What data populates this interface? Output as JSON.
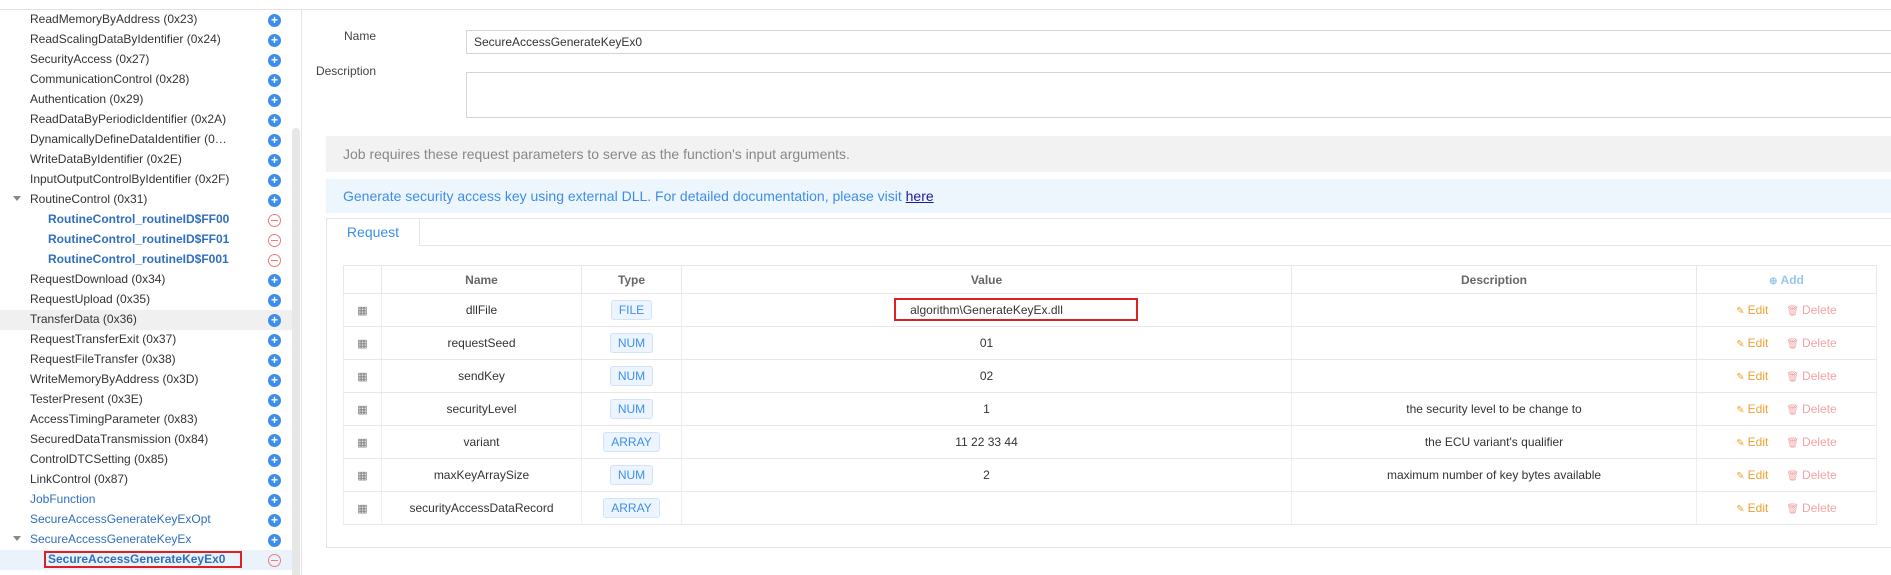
{
  "sidebar": {
    "items": [
      {
        "label": "ReadMemoryByAddress (0x23)",
        "style": "normal",
        "indent": 1,
        "action": "add"
      },
      {
        "label": "ReadScalingDataByIdentifier (0x24)",
        "style": "normal",
        "indent": 1,
        "action": "add"
      },
      {
        "label": "SecurityAccess (0x27)",
        "style": "normal",
        "indent": 1,
        "action": "add"
      },
      {
        "label": "CommunicationControl (0x28)",
        "style": "normal",
        "indent": 1,
        "action": "add"
      },
      {
        "label": "Authentication (0x29)",
        "style": "normal",
        "indent": 1,
        "action": "add"
      },
      {
        "label": "ReadDataByPeriodicIdentifier (0x2A)",
        "style": "normal",
        "indent": 1,
        "action": "add"
      },
      {
        "label": "DynamicallyDefineDataIdentifier (0…",
        "style": "normal",
        "indent": 1,
        "action": "add"
      },
      {
        "label": "WriteDataByIdentifier (0x2E)",
        "style": "normal",
        "indent": 1,
        "action": "add"
      },
      {
        "label": "InputOutputControlByIdentifier (0x2F)",
        "style": "normal",
        "indent": 1,
        "action": "add"
      },
      {
        "label": "RoutineControl (0x31)",
        "style": "normal",
        "indent": 1,
        "action": "add",
        "expanded": true
      },
      {
        "label": "RoutineControl_routineID$FF00",
        "style": "bold",
        "indent": 2,
        "action": "remove"
      },
      {
        "label": "RoutineControl_routineID$FF01",
        "style": "bold",
        "indent": 2,
        "action": "remove"
      },
      {
        "label": "RoutineControl_routineID$F001",
        "style": "bold",
        "indent": 2,
        "action": "remove"
      },
      {
        "label": "RequestDownload (0x34)",
        "style": "normal",
        "indent": 1,
        "action": "add"
      },
      {
        "label": "RequestUpload (0x35)",
        "style": "normal",
        "indent": 1,
        "action": "add"
      },
      {
        "label": "TransferData (0x36)",
        "style": "normal",
        "indent": 1,
        "action": "add",
        "highlight": true
      },
      {
        "label": "RequestTransferExit (0x37)",
        "style": "normal",
        "indent": 1,
        "action": "add"
      },
      {
        "label": "RequestFileTransfer (0x38)",
        "style": "normal",
        "indent": 1,
        "action": "add"
      },
      {
        "label": "WriteMemoryByAddress (0x3D)",
        "style": "normal",
        "indent": 1,
        "action": "add"
      },
      {
        "label": "TesterPresent (0x3E)",
        "style": "normal",
        "indent": 1,
        "action": "add"
      },
      {
        "label": "AccessTimingParameter (0x83)",
        "style": "normal",
        "indent": 1,
        "action": "add"
      },
      {
        "label": "SecuredDataTransmission (0x84)",
        "style": "normal",
        "indent": 1,
        "action": "add"
      },
      {
        "label": "ControlDTCSetting (0x85)",
        "style": "normal",
        "indent": 1,
        "action": "add"
      },
      {
        "label": "LinkControl (0x87)",
        "style": "normal",
        "indent": 1,
        "action": "add"
      },
      {
        "label": "JobFunction",
        "style": "blue",
        "indent": 1,
        "action": "add"
      },
      {
        "label": "SecureAccessGenerateKeyExOpt",
        "style": "blue",
        "indent": 1,
        "action": "add"
      },
      {
        "label": "SecureAccessGenerateKeyEx",
        "style": "blue",
        "indent": 1,
        "action": "add",
        "expanded": true
      },
      {
        "label": "SecureAccessGenerateKeyEx0",
        "style": "bold",
        "indent": 2,
        "action": "remove",
        "selected": true
      }
    ]
  },
  "form": {
    "name_label": "Name",
    "name_value": "SecureAccessGenerateKeyEx0",
    "description_label": "Description",
    "description_value": ""
  },
  "info": {
    "grey_text": "Job requires these request parameters to serve as the function's input arguments.",
    "blue_text": "Generate security access key using external DLL. For detailed documentation, please visit ",
    "link_text": "here"
  },
  "tabs": {
    "request": "Request"
  },
  "table": {
    "headers": {
      "name": "Name",
      "type": "Type",
      "value": "Value",
      "description": "Description",
      "add": "Add"
    },
    "edit_label": "Edit",
    "delete_label": "Delete",
    "rows": [
      {
        "name": "dllFile",
        "type": "FILE",
        "value": "algorithm\\GenerateKeyEx.dll",
        "description": ""
      },
      {
        "name": "requestSeed",
        "type": "NUM",
        "value": "01",
        "description": ""
      },
      {
        "name": "sendKey",
        "type": "NUM",
        "value": "02",
        "description": ""
      },
      {
        "name": "securityLevel",
        "type": "NUM",
        "value": "1",
        "description": "the security level to be change to"
      },
      {
        "name": "variant",
        "type": "ARRAY",
        "value": "11 22 33 44",
        "description": "the ECU variant's qualifier"
      },
      {
        "name": "maxKeyArraySize",
        "type": "NUM",
        "value": "2",
        "description": "maximum number of key bytes available"
      },
      {
        "name": "securityAccessDataRecord",
        "type": "ARRAY",
        "value": "",
        "description": ""
      }
    ]
  },
  "colors": {
    "accent": "#3d8eea",
    "highlight_box": "#e02020",
    "edit": "#f0a030",
    "delete": "#f4a3a3"
  }
}
